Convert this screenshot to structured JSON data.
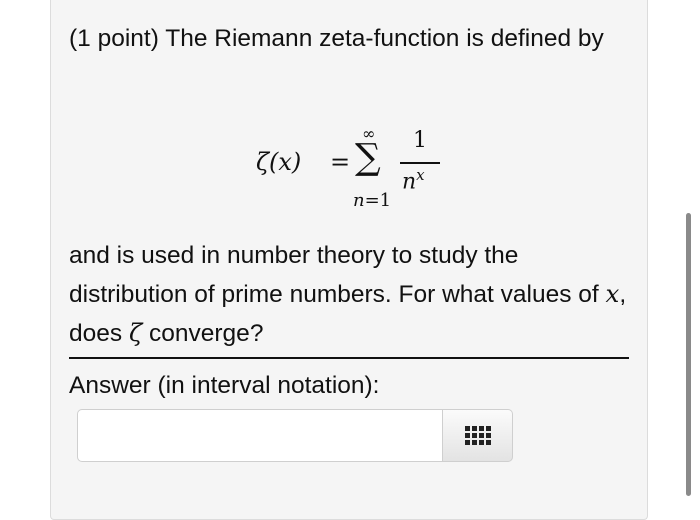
{
  "problem": {
    "intro": "(1 point) The Riemann zeta-function is defined by",
    "formula": {
      "lhs": "ζ(x)",
      "equals": "=",
      "upper_limit": "∞",
      "sigma": "∑",
      "lower_var": "n",
      "lower_eq": "=1",
      "numerator": "1",
      "denominator_base": "n",
      "denominator_exp": "x"
    },
    "body_part1": "and is used in number theory to study the distribution of prime numbers. For what values of ",
    "body_var_x": "x",
    "body_part2": ", does ",
    "body_var_zeta": "ζ",
    "body_part3": " converge?"
  },
  "answer": {
    "label": "Answer (in interval notation):",
    "value": "",
    "placeholder": ""
  },
  "icons": {
    "palette": "grid-icon"
  }
}
